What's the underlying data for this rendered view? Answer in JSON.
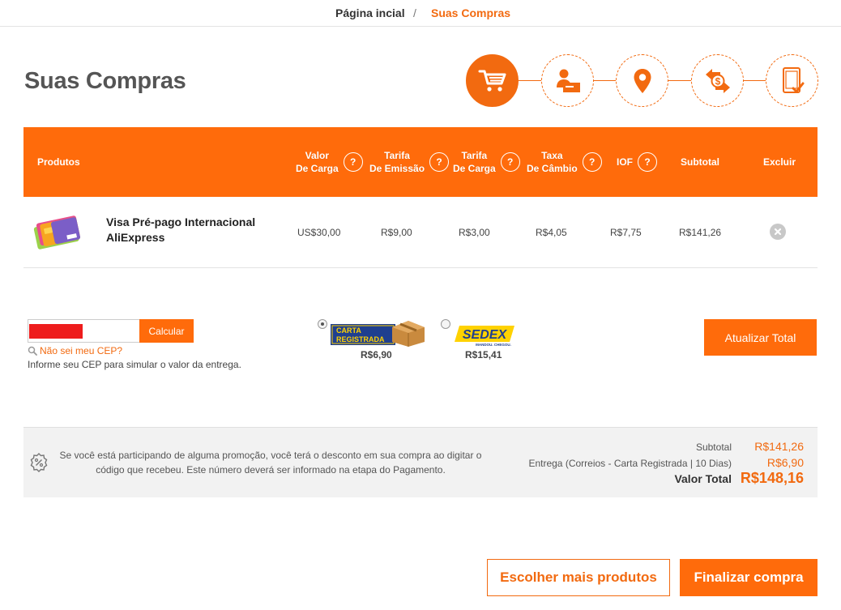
{
  "breadcrumb": {
    "home": "Página incial",
    "separator": "/",
    "current": "Suas Compras"
  },
  "page": {
    "title": "Suas Compras"
  },
  "steps": [
    {
      "icon": "cart-icon",
      "active": true
    },
    {
      "icon": "user-card-icon",
      "active": false
    },
    {
      "icon": "location-pin-icon",
      "active": false
    },
    {
      "icon": "money-exchange-icon",
      "active": false
    },
    {
      "icon": "tablet-check-icon",
      "active": false
    }
  ],
  "table": {
    "headers": {
      "produtos": "Produtos",
      "valor_carga": [
        "Valor",
        "De Carga"
      ],
      "tarifa_emissao": [
        "Tarifa",
        "De Emissão"
      ],
      "tarifa_carga": [
        "Tarifa",
        "De Carga"
      ],
      "taxa_cambio": [
        "Taxa",
        "De Câmbio"
      ],
      "iof": "IOF",
      "subtotal": "Subtotal",
      "excluir": "Excluir",
      "help": "?"
    },
    "row": {
      "name_line1": "Visa Pré-pago Internacional",
      "name_line2": "AliExpress",
      "valor_carga": "US$30,00",
      "tarifa_emissao": "R$9,00",
      "tarifa_carga": "R$3,00",
      "taxa_cambio": "R$4,05",
      "iof": "R$7,75",
      "subtotal": "R$141,26"
    }
  },
  "shipping": {
    "calc_label": "Calcular",
    "cep_link": "Não sei meu CEP?",
    "cep_help": "Informe seu CEP para simular o valor da entrega.",
    "options": [
      {
        "logo_line1": "CARTA",
        "logo_line2": "REGISTRADA",
        "price": "R$6,90",
        "selected": true
      },
      {
        "logo": "SEDEX",
        "logo_sub": "MANDOU. CHEGOU.",
        "price": "R$15,41",
        "selected": false
      }
    ],
    "update_label": "Atualizar Total"
  },
  "summary": {
    "promo_text": "Se você está participando de alguma promoção, você terá o desconto em sua compra ao digitar o código que recebeu. Este número deverá ser informado na etapa do Pagamento.",
    "subtotal_label": "Subtotal",
    "subtotal_value": "R$141,26",
    "delivery_label": "Entrega (Correios - Carta Registrada | 10 Dias)",
    "delivery_value": "R$6,90",
    "total_label": "Valor Total",
    "total_value": "R$148,16"
  },
  "actions": {
    "more_label": "Escolher mais produtos",
    "finish_label": "Finalizar compra"
  },
  "colors": {
    "accent": "#ff6b0b",
    "accent_text": "#f26a10"
  }
}
